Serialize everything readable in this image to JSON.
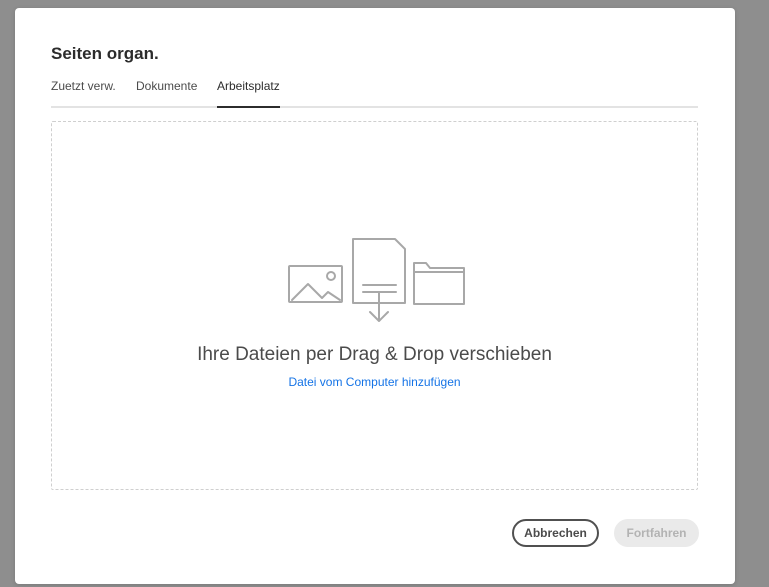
{
  "dialog": {
    "title": "Seiten organ."
  },
  "tabs": [
    {
      "label": "Zuetzt verw.",
      "active": false
    },
    {
      "label": "Dokumente",
      "active": false
    },
    {
      "label": "Arbeitsplatz",
      "active": true
    }
  ],
  "dropzone": {
    "title": "Ihre Dateien per Drag & Drop verschieben",
    "link": "Datei vom Computer hinzufügen",
    "icons": [
      "image-icon",
      "document-download-icon",
      "folder-icon"
    ]
  },
  "actions": {
    "cancel_label": "Abbrechen",
    "continue_label": "Fortfahren"
  },
  "colors": {
    "backdrop": "#8e8e8e",
    "text": "#2c2c2c",
    "link": "#1473e6",
    "disabled_bg": "#eaeaea",
    "disabled_text": "#b3b3b3",
    "icon_stroke": "#a8a8a8"
  }
}
